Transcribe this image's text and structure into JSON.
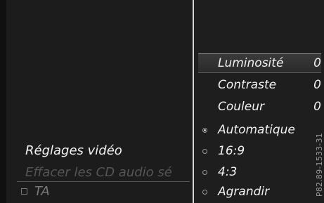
{
  "left_panel": {
    "title": "Réglages vidéo",
    "faded_item": "Effacer les CD audio sé",
    "ta_label": "TA"
  },
  "menu": {
    "items": [
      {
        "label": "Luminosité",
        "value": "0",
        "selected": true
      },
      {
        "label": "Contraste",
        "value": "0"
      },
      {
        "label": "Couleur",
        "value": "0"
      },
      {
        "label": "Automatique",
        "radio": "on"
      },
      {
        "label": "16:9",
        "radio": "off"
      },
      {
        "label": "4:3",
        "radio": "off"
      },
      {
        "label": "Agrandir",
        "radio": "off"
      }
    ]
  },
  "figure_code": "P82.89-1533-31"
}
